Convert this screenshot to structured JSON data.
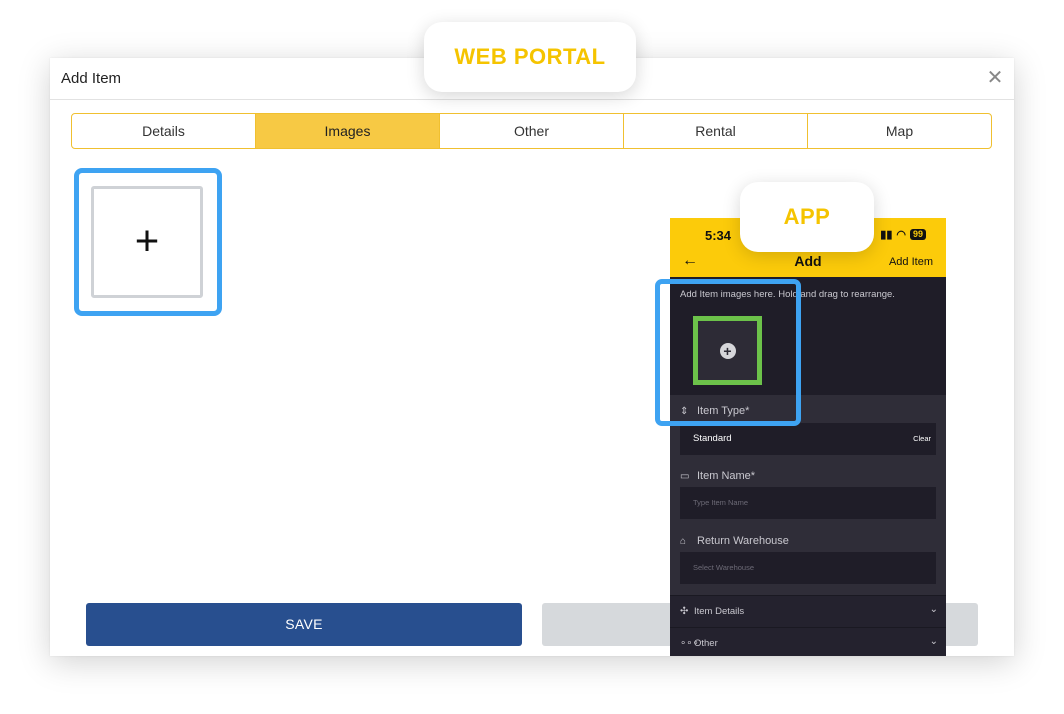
{
  "labels": {
    "web_portal": "WEB PORTAL",
    "app": "APP"
  },
  "modal": {
    "title": "Add Item",
    "close_symbol": "✕",
    "tabs": [
      "Details",
      "Images",
      "Other",
      "Rental",
      "Map"
    ],
    "active_tab": "Images",
    "add_image_symbol": "+",
    "save_label": "SAVE"
  },
  "phone": {
    "status_time": "5:34",
    "battery": "99",
    "back_symbol": "←",
    "nav_title": "Add",
    "nav_action": "Add Item",
    "image_hint": "Add Item images here. Hold and drag to rearrange.",
    "add_image_symbol": "+",
    "item_type_label": "Item Type*",
    "item_type_value": "Standard",
    "clear_label": "Clear",
    "item_name_label": "Item Name*",
    "item_name_placeholder": "Type Item Name",
    "warehouse_label": "Return Warehouse",
    "warehouse_placeholder": "Select Warehouse",
    "item_details_label": "Item Details",
    "other_label": "Other"
  },
  "colors": {
    "accent_yellow": "#f7c944",
    "highlight_blue": "#3ea3f2",
    "highlight_green": "#6cc24a",
    "save_blue": "#284f8f",
    "phone_bg": "#24222e"
  },
  "icons": {
    "close": "close-icon",
    "plus": "plus-icon",
    "back": "back-arrow-icon",
    "sort": "sort-arrows-icon",
    "tag": "tag-icon",
    "warehouse": "warehouse-icon",
    "tools": "tools-icon",
    "more": "more-dots-icon",
    "chevron": "chevron-down-icon"
  }
}
